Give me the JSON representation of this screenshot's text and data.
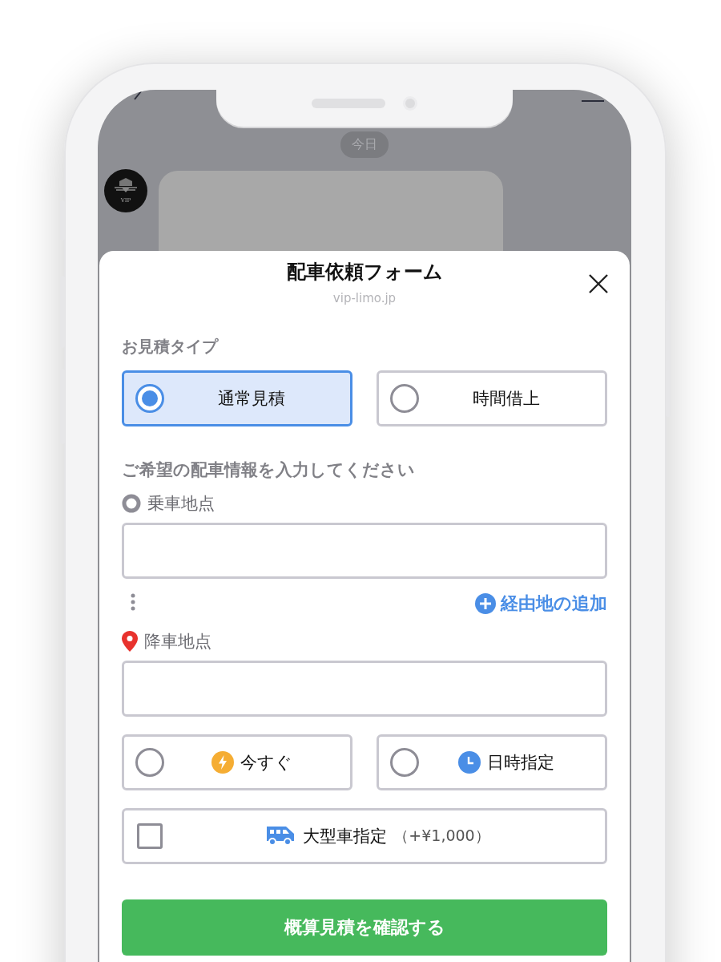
{
  "chat": {
    "date_badge": "今日",
    "avatar_text": "VIP"
  },
  "sheet": {
    "title": "配車依頼フォーム",
    "domain": "vip-limo.jp"
  },
  "quote_type": {
    "label": "お見積タイプ",
    "options": [
      {
        "label": "通常見積",
        "selected": true
      },
      {
        "label": "時間借上",
        "selected": false
      }
    ]
  },
  "ride": {
    "heading": "ご希望の配車情報を入力してください",
    "locations": [
      {
        "kind": "pickup",
        "label": "乗車地点"
      },
      {
        "kind": "dropoff",
        "label": "降車地点"
      }
    ],
    "add_stop": "経由地の追加",
    "timing": [
      {
        "kind": "now",
        "label": "今すぐ",
        "selected": false
      },
      {
        "kind": "scheduled",
        "label": "日時指定",
        "selected": false
      }
    ],
    "large_vehicle": {
      "label": "大型車指定",
      "price": "（+¥1,000）",
      "checked": false
    }
  },
  "submit": "概算見積を確認する"
}
